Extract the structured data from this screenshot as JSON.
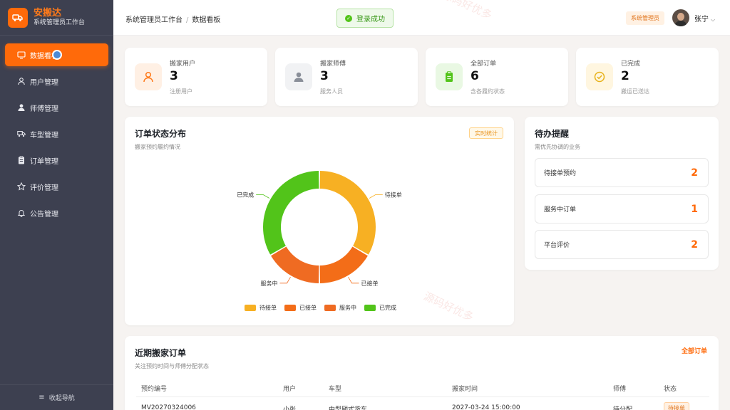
{
  "brand": {
    "title": "安搬达",
    "subtitle": "系统管理员工作台"
  },
  "sidebar": {
    "items": [
      {
        "label": "数据看板",
        "icon": "dashboard-icon",
        "active": true
      },
      {
        "label": "用户管理",
        "icon": "user-icon"
      },
      {
        "label": "师傅管理",
        "icon": "worker-icon"
      },
      {
        "label": "车型管理",
        "icon": "truck-icon"
      },
      {
        "label": "订单管理",
        "icon": "clipboard-icon"
      },
      {
        "label": "评价管理",
        "icon": "star-icon"
      },
      {
        "label": "公告管理",
        "icon": "bell-icon"
      }
    ],
    "collapse_label": "收起导航"
  },
  "header": {
    "breadcrumb": [
      "系统管理员工作台",
      "数据看板"
    ],
    "toast": "登录成功",
    "role_badge": "系统管理员",
    "user_name": "张宁"
  },
  "stats": [
    {
      "label": "搬家用户",
      "value": "3",
      "sub": "注册用户",
      "icon": "user-icon",
      "color": "#ff7a1a",
      "bg": "#fff0e4"
    },
    {
      "label": "搬家师傅",
      "value": "3",
      "sub": "服务人员",
      "icon": "worker-icon",
      "color": "#8a8f99",
      "bg": "#f1f2f4"
    },
    {
      "label": "全部订单",
      "value": "6",
      "sub": "含各履约状态",
      "icon": "clipboard-icon",
      "color": "#52c41a",
      "bg": "#e9f8e3"
    },
    {
      "label": "已完成",
      "value": "2",
      "sub": "搬运已送达",
      "icon": "check-circle-icon",
      "color": "#e8b21a",
      "bg": "#fff6e0"
    }
  ],
  "order_status": {
    "title": "订单状态分布",
    "subtitle": "搬家预约履约情况",
    "tag": "实时统计"
  },
  "chart_data": {
    "type": "pie",
    "categories": [
      "待接单",
      "已接单",
      "服务中",
      "已完成"
    ],
    "values": [
      2,
      1,
      1,
      2
    ],
    "colors": [
      "#f7b023",
      "#f36d18",
      "#ef6b22",
      "#52c41a"
    ],
    "legend_position": "bottom"
  },
  "todo": {
    "title": "待办提醒",
    "subtitle": "需优先协调的业务",
    "items": [
      {
        "label": "待接单预约",
        "count": "2"
      },
      {
        "label": "服务中订单",
        "count": "1"
      },
      {
        "label": "平台评价",
        "count": "2"
      }
    ]
  },
  "recent": {
    "title": "近期搬家订单",
    "subtitle": "关注预约时间与师傅分配状态",
    "link": "全部订单",
    "columns": [
      "预约编号",
      "用户",
      "车型",
      "搬家时间",
      "师傅",
      "状态"
    ],
    "rows": [
      {
        "id": "MV20270324006",
        "user": "小张",
        "vehicle": "中型厢式货车",
        "time": "2027-03-24 15:00:00",
        "worker": "待分配",
        "status": "待接单"
      }
    ]
  },
  "watermark": "源码好优多"
}
